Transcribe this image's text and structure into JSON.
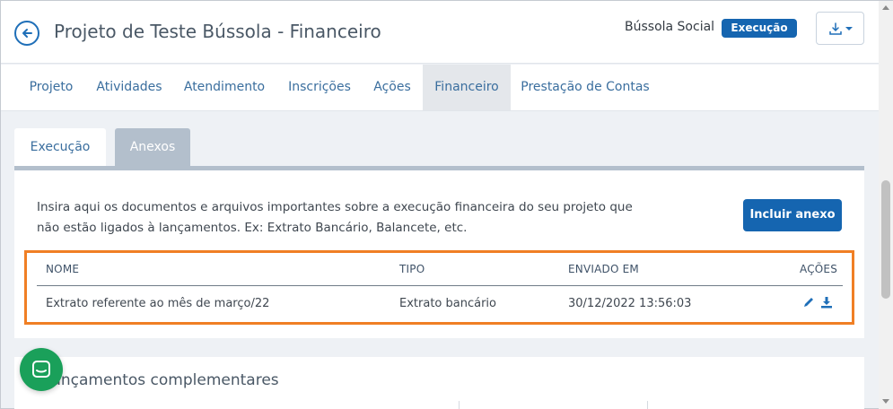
{
  "header": {
    "title": "Projeto de Teste Bússola - Financeiro",
    "org_name": "Bússola Social",
    "status": "Execução",
    "back_icon": "arrow-left-icon",
    "download_icon": "download-dropdown-icon"
  },
  "nav": {
    "tabs": [
      {
        "label": "Projeto"
      },
      {
        "label": "Atividades"
      },
      {
        "label": "Atendimento"
      },
      {
        "label": "Inscrições"
      },
      {
        "label": "Ações"
      },
      {
        "label": "Financeiro",
        "active": true
      },
      {
        "label": "Prestação de Contas"
      }
    ]
  },
  "subtabs": {
    "execucao": "Execução",
    "anexos": "Anexos",
    "active": "Anexos"
  },
  "attachments": {
    "description_line1": "Insira aqui os documentos e arquivos importantes sobre a execução financeira do seu projeto que",
    "description_line2": "não estão ligados à lançamentos. Ex: Extrato Bancário, Balancete, etc.",
    "add_button": "Incluir anexo",
    "columns": [
      "NOME",
      "TIPO",
      "ENVIADO EM",
      "AÇÕES"
    ],
    "rows": [
      {
        "nome": "Extrato referente ao mês de março/22",
        "tipo": "Extrato bancário",
        "enviado_em": "30/12/2022 13:56:03"
      }
    ]
  },
  "complementares": {
    "title": "Lançamentos complementares"
  },
  "colors": {
    "primary": "#1565b0",
    "highlight_border": "#f07f24",
    "chat": "#1aa05a"
  }
}
